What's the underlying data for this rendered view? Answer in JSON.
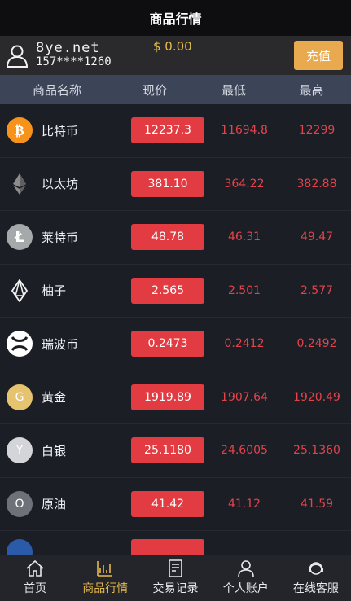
{
  "header": {
    "title": "商品行情"
  },
  "account": {
    "site": "8ye.net",
    "phone": "157****1260",
    "balance": "$ 0.00",
    "recharge_label": "充值"
  },
  "columns": {
    "name": "商品名称",
    "price": "现价",
    "low": "最低",
    "high": "最高"
  },
  "rows": [
    {
      "name": "比特币",
      "icon": "bitcoin-icon",
      "price": "12237.3",
      "low": "11694.8",
      "high": "12299"
    },
    {
      "name": "以太坊",
      "icon": "ethereum-icon",
      "price": "381.10",
      "low": "364.22",
      "high": "382.88"
    },
    {
      "name": "莱特币",
      "icon": "litecoin-icon",
      "price": "48.78",
      "low": "46.31",
      "high": "49.47"
    },
    {
      "name": "柚子",
      "icon": "eos-icon",
      "price": "2.565",
      "low": "2.501",
      "high": "2.577"
    },
    {
      "name": "瑞波币",
      "icon": "ripple-icon",
      "price": "0.2473",
      "low": "0.2412",
      "high": "0.2492"
    },
    {
      "name": "黄金",
      "icon": "gold-icon",
      "glyph": "G",
      "price": "1919.89",
      "low": "1907.64",
      "high": "1920.49"
    },
    {
      "name": "白银",
      "icon": "silver-icon",
      "glyph": "Y",
      "price": "25.1180",
      "low": "24.6005",
      "high": "25.1360"
    },
    {
      "name": "原油",
      "icon": "oil-icon",
      "glyph": "O",
      "price": "41.42",
      "low": "41.12",
      "high": "41.59"
    }
  ],
  "tabs": [
    {
      "label": "首页",
      "icon": "home-icon"
    },
    {
      "label": "商品行情",
      "icon": "chart-icon",
      "active": true
    },
    {
      "label": "交易记录",
      "icon": "records-icon"
    },
    {
      "label": "个人账户",
      "icon": "user-icon"
    },
    {
      "label": "在线客服",
      "icon": "service-icon"
    }
  ],
  "colors": {
    "price_bg": "#e23b41",
    "accent": "#e5b94a",
    "header_bg": "#3c4458",
    "bg": "#1c1e26"
  }
}
